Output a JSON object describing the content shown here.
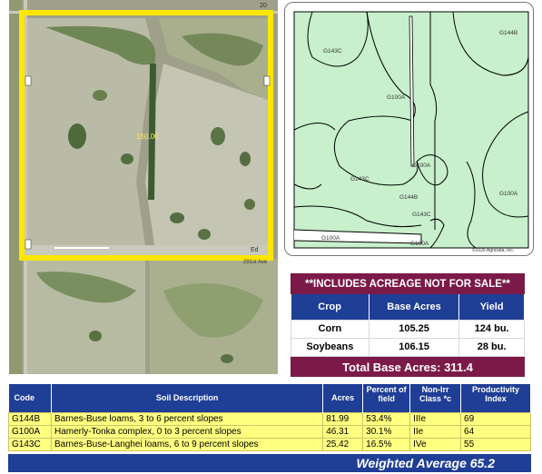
{
  "aerial": {
    "area_label": "160.00",
    "road_label_top": "20",
    "road_label_side": "291st Ave",
    "edge_label": "Ed"
  },
  "soil_map": {
    "labels": [
      "G143C",
      "G144B",
      "G100A",
      "G100A",
      "G143C",
      "G144B",
      "G100A",
      "G143C",
      "G100A",
      "G100A"
    ],
    "copyright": "©2026 AgriData, Inc."
  },
  "base_acres": {
    "banner": "**INCLUDES ACREAGE NOT FOR SALE**",
    "headers": [
      "Crop",
      "Base Acres",
      "Yield"
    ],
    "rows": [
      {
        "crop": "Corn",
        "base_acres": "105.25",
        "yield": "124 bu."
      },
      {
        "crop": "Soybeans",
        "base_acres": "106.15",
        "yield": "28 bu."
      }
    ],
    "total": "Total Base Acres:  311.4"
  },
  "soil_table": {
    "headers": [
      "Code",
      "Soil Description",
      "Acres",
      "Percent of field",
      "Non-Irr Class *c",
      "Productivity Index"
    ],
    "rows": [
      {
        "code": "G144B",
        "desc": "Barnes-Buse loams, 3 to 6 percent slopes",
        "acres": "81.99",
        "pct": "53.4%",
        "cls": "IIIe",
        "pi": "69"
      },
      {
        "code": "G100A",
        "desc": "Hamerly-Tonka complex, 0 to 3 percent slopes",
        "acres": "46.31",
        "pct": "30.1%",
        "cls": "IIe",
        "pi": "64"
      },
      {
        "code": "G143C",
        "desc": "Barnes-Buse-Langhei loams, 6 to 9 percent slopes",
        "acres": "25.42",
        "pct": "16.5%",
        "cls": "IVe",
        "pi": "55"
      }
    ],
    "weighted_average": "Weighted Average  65.2"
  },
  "colors": {
    "maroon": "#7b1a48",
    "navy": "#1f3e95",
    "yellow_row": "#ffff80",
    "soil_fill": "#c8f0cc",
    "boundary": "#ffe600"
  }
}
